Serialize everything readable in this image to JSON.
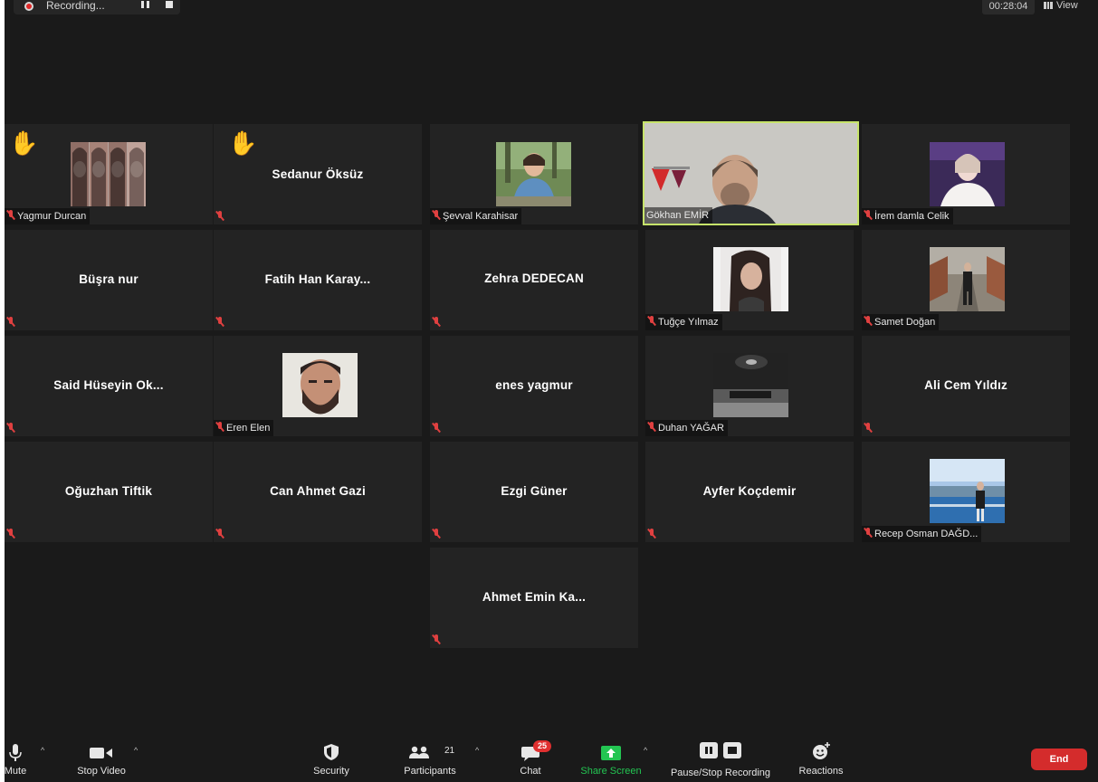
{
  "top": {
    "recording_label": "Recording...",
    "timer": "00:28:04",
    "view_label": "View"
  },
  "tiles": [
    {
      "name": "Yagmur Durcan",
      "hand": "✋"
    },
    {
      "name": "Sedanur Öksüz",
      "hand": "✋"
    },
    {
      "name": "Şevval Karahisar"
    },
    {
      "name": "Gökhan EMİR"
    },
    {
      "name": "İrem damla Celik"
    },
    {
      "name": "Büşra nur"
    },
    {
      "name": "Fatih Han Karay..."
    },
    {
      "name": "Zehra DEDECAN"
    },
    {
      "name": "Tuğçe Yılmaz"
    },
    {
      "name": "Samet Doğan"
    },
    {
      "name": "Said Hüseyin Ok..."
    },
    {
      "name": "Eren Elen"
    },
    {
      "name": "enes yagmur"
    },
    {
      "name": "Duhan YAĞAR"
    },
    {
      "name": "Ali Cem Yıldız"
    },
    {
      "name": "Oğuzhan Tiftik"
    },
    {
      "name": "Can Ahmet Gazi"
    },
    {
      "name": "Ezgi Güner"
    },
    {
      "name": "Ayfer Koçdemir"
    },
    {
      "name": "Recep Osman DAĞD..."
    },
    {
      "name": "Ahmet Emin Ka..."
    }
  ],
  "toolbar": {
    "mute": "Mute",
    "stop_video": "Stop Video",
    "security": "Security",
    "participants": "Participants",
    "participants_count": "21",
    "chat": "Chat",
    "chat_badge": "25",
    "share_screen": "Share Screen",
    "pause_stop_recording": "Pause/Stop Recording",
    "reactions": "Reactions",
    "end": "End"
  },
  "colors": {
    "background": "#1a1a1a",
    "tile": "#232323",
    "active_speaker": "#c6e36a",
    "share_green": "#23c552",
    "end_red": "#d42c2c",
    "muted_red": "#e04040"
  }
}
